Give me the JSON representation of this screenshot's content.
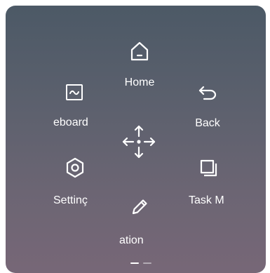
{
  "menu": {
    "home": {
      "label": "Home",
      "icon": "home-icon"
    },
    "whiteboard": {
      "label": "eboard",
      "icon": "whiteboard-icon"
    },
    "back": {
      "label": "Back",
      "icon": "back-arrow-icon"
    },
    "settings": {
      "label": "Settinç",
      "icon": "settings-hexagon-icon"
    },
    "task_manager": {
      "label": "Task M",
      "icon": "task-manager-icon"
    },
    "annotation": {
      "label": "ation",
      "icon": "pencil-icon"
    },
    "move": {
      "icon": "move-arrows-icon"
    }
  },
  "pager": {
    "active_page": 1,
    "total_pages": 2
  }
}
